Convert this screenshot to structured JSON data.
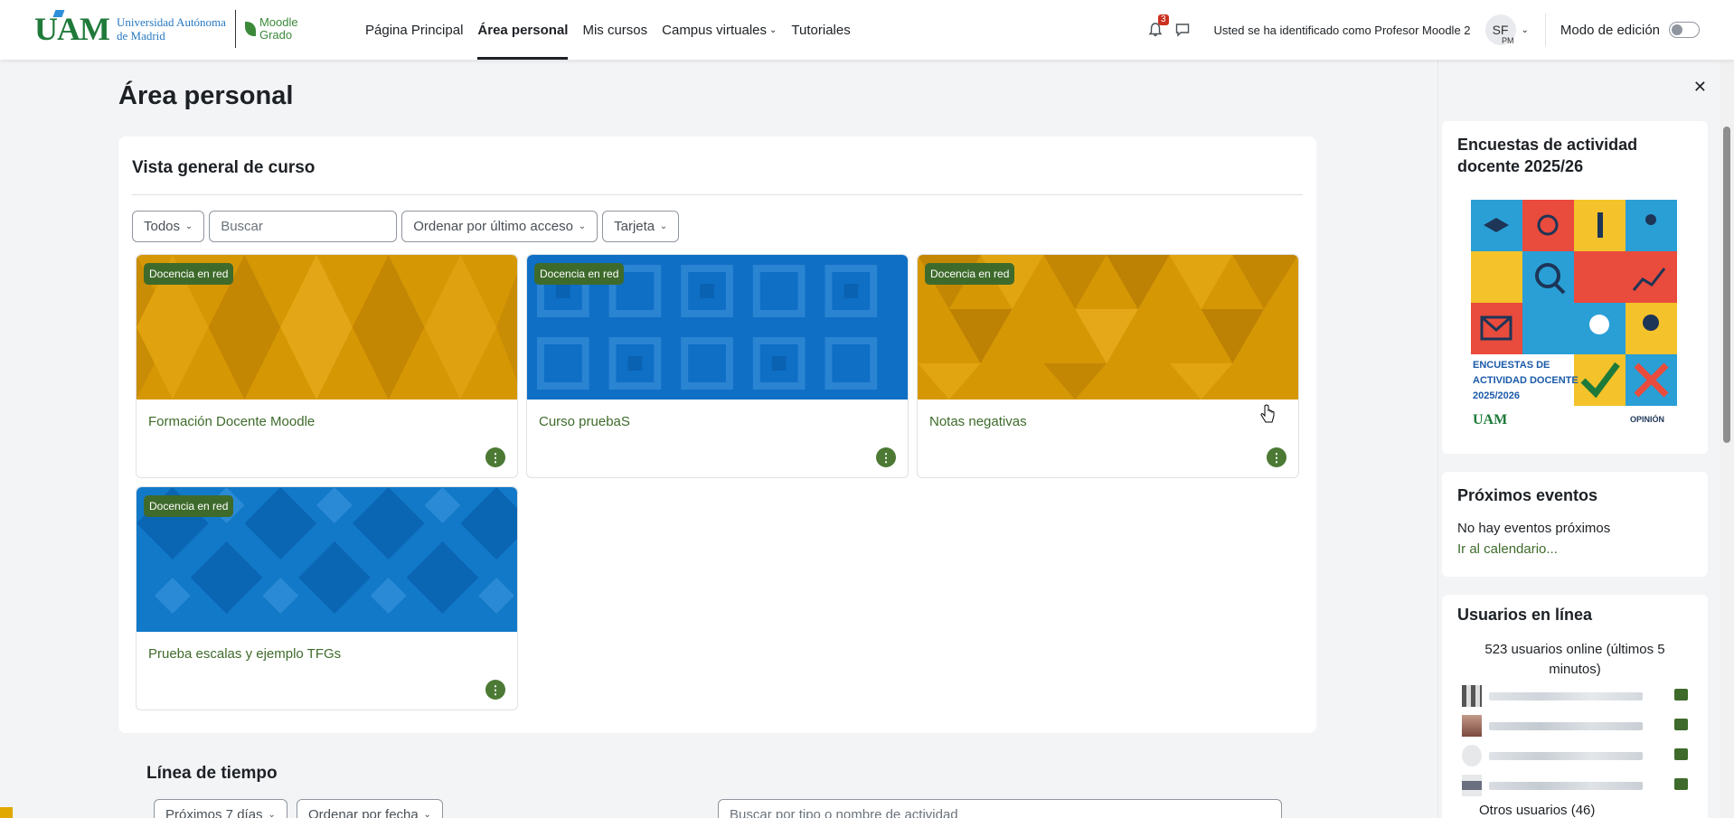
{
  "header": {
    "logo_uam": "UAM",
    "logo_uni_line1": "Universidad Autónoma",
    "logo_uni_line2": "de Madrid",
    "logo_moodle_line1": "Moodle",
    "logo_moodle_line2": "Grado",
    "nav": [
      {
        "label": "Página Principal"
      },
      {
        "label": "Área personal"
      },
      {
        "label": "Mis cursos"
      },
      {
        "label": "Campus virtuales"
      },
      {
        "label": "Tutoriales"
      }
    ],
    "notification_count": "3",
    "login_info": "Usted se ha identificado como Profesor Moodle 2",
    "avatar_initials": "SF",
    "avatar_sub": "PM",
    "edit_mode_label": "Modo de edición",
    "edit_mode_on": false
  },
  "main": {
    "page_title": "Área personal",
    "overview": {
      "title": "Vista general de curso",
      "filter_all": "Todos",
      "search_placeholder": "Buscar",
      "sort": "Ordenar por último acceso",
      "view": "Tarjeta",
      "courses": [
        {
          "name": "Formación Docente Moodle",
          "badge": "Docencia en red",
          "color": "#d69705"
        },
        {
          "name": "Curso pruebaS",
          "badge": "Docencia en red",
          "color": "#0f6fc5"
        },
        {
          "name": "Notas negativas",
          "badge": "Docencia en red",
          "color": "#d69705"
        },
        {
          "name": "Prueba escalas y ejemplo TFGs",
          "badge": "Docencia en red",
          "color": "#1279c8"
        }
      ]
    },
    "timeline": {
      "title": "Línea de tiempo",
      "range": "Próximos 7 días",
      "sort": "Ordenar por fecha",
      "search_placeholder": "Buscar por tipo o nombre de actividad"
    }
  },
  "drawer": {
    "encuestas_title": "Encuestas de actividad docente 2025/26",
    "encuestas_img_text1": "ENCUESTAS DE",
    "encuestas_img_text2": "ACTIVIDAD DOCENTE",
    "encuestas_img_text3": "2025/2026",
    "encuestas_img_brand": "OPINIÓN",
    "events_title": "Próximos eventos",
    "events_none": "No hay eventos próximos",
    "events_link": "Ir al calendario...",
    "online_title": "Usuarios en línea",
    "online_count": "523 usuarios online (últimos 5 minutos)",
    "online_others": "Otros usuarios (46)"
  },
  "colors": {
    "accent_green": "#3e6b2b",
    "badge_red": "#ca3120"
  }
}
